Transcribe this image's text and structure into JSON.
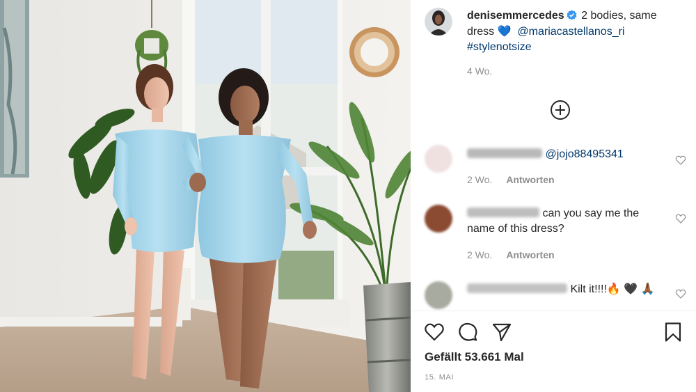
{
  "post": {
    "author": "denisemmercedes",
    "caption_text": "2 bodies, same dress",
    "caption_emoji": "💙",
    "mention": "@mariacastellanos_ri",
    "hashtag": "#stylenotsize",
    "caption_age": "4 Wo."
  },
  "comments": [
    {
      "mention": "@jojo88495341",
      "text": "",
      "age": "2 Wo.",
      "reply_label": ""
    },
    {
      "mention": "",
      "text_line1": "can you say me the",
      "text_line2": "name of this dress?",
      "age": "2 Wo.",
      "reply_label": "Antworten"
    },
    {
      "text": "Kilt it!!!!🔥 🖤 🙏🏾"
    }
  ],
  "reply_label": "Antworten",
  "likes_text": "Gefällt 53.661 Mal",
  "post_date": "15. MAI",
  "icons": {
    "verified": "verified-badge-icon",
    "load_more": "plus-circle-icon",
    "like": "heart-icon",
    "comment": "comment-bubble-icon",
    "share": "paper-plane-icon",
    "save": "bookmark-icon"
  },
  "colors": {
    "username": "#262626",
    "link": "#00376b",
    "meta": "#8e8e8e",
    "verified": "#3897f0",
    "dress": "#a9d8ec"
  }
}
